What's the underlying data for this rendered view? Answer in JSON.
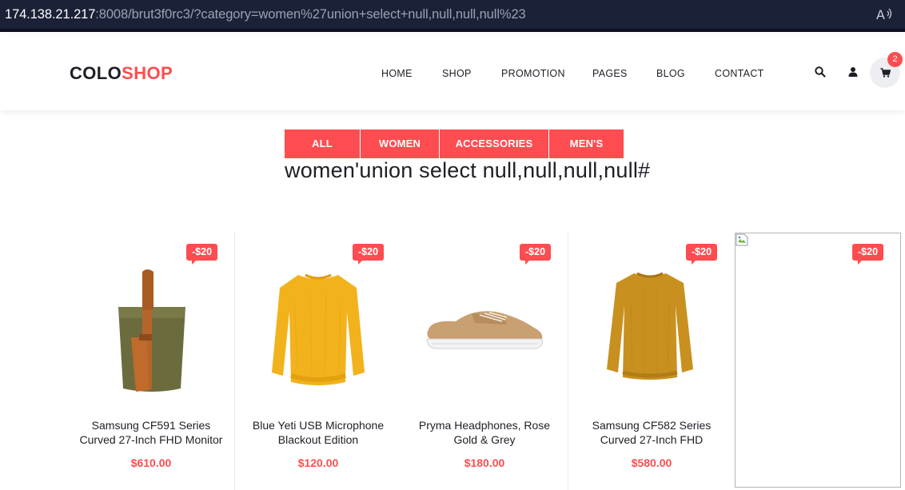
{
  "browser": {
    "url_host": "174.138.21.217",
    "url_rest": ":8008/brut3f0rc3/?category=women%27union+select+null,null,null,null%23",
    "read_aloud_icon": "read-aloud-icon"
  },
  "header": {
    "logo_part1": "COLO",
    "logo_part2": "SHOP",
    "nav": [
      "HOME",
      "SHOP",
      "PROMOTION",
      "PAGES",
      "BLOG",
      "CONTACT"
    ],
    "icons": [
      "search-icon",
      "user-icon",
      "cart-icon"
    ],
    "cart_count": "2"
  },
  "filters": [
    "ALL",
    "WOMEN",
    "ACCESSORIES",
    "MEN'S"
  ],
  "query_title": "women'union select null,null,null,null#",
  "products": [
    {
      "discount": "-$20",
      "name_line1": "Samsung CF591 Series",
      "name_line2": "Curved 27-Inch FHD Monitor",
      "price": "$610.00",
      "image": "bag"
    },
    {
      "discount": "-$20",
      "name_line1": "Blue Yeti USB Microphone",
      "name_line2": "Blackout Edition",
      "price": "$120.00",
      "image": "yellow-sweater"
    },
    {
      "discount": "-$20",
      "name_line1": "Pryma Headphones, Rose",
      "name_line2": "Gold & Grey",
      "price": "$180.00",
      "image": "sneaker"
    },
    {
      "discount": "-$20",
      "name_line1": "Samsung CF582 Series",
      "name_line2": "Curved 27-Inch FHD",
      "price": "$580.00",
      "image": "mustard-sweater"
    },
    {
      "discount": "-$20",
      "image": "broken-image"
    }
  ],
  "colors": {
    "accent": "#fe4c50",
    "text": "#1e1e27",
    "address_bar": "#1b2137"
  }
}
